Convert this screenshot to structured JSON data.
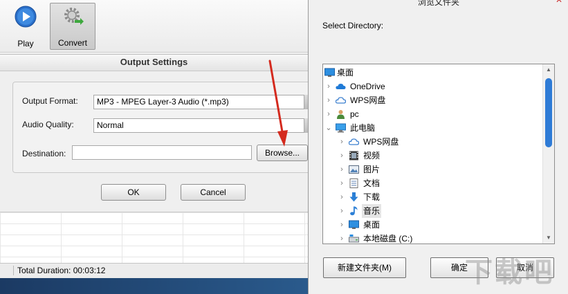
{
  "toolbar": {
    "play_label": "Play",
    "convert_label": "Convert"
  },
  "output_settings": {
    "title": "Output Settings",
    "output_format_label": "Output Format:",
    "output_format_value": "MP3 - MPEG Layer-3 Audio (*.mp3)",
    "audio_quality_label": "Audio Quality:",
    "audio_quality_value": "Normal",
    "destination_label": "Destination:",
    "destination_value": "",
    "browse_label": "Browse...",
    "ok_label": "OK",
    "cancel_label": "Cancel"
  },
  "status": {
    "total_duration": "Total Duration: 00:03:12"
  },
  "browse_dialog": {
    "title": "浏览文件夹",
    "select_directory_label": "Select Directory:",
    "tree": [
      {
        "label": "桌面",
        "icon": "desktop-icon",
        "level": 0,
        "expand": "none"
      },
      {
        "label": "OneDrive",
        "icon": "cloud-icon",
        "level": 1,
        "expand": "collapsed"
      },
      {
        "label": "WPS网盘",
        "icon": "cloud-outline-icon",
        "level": 1,
        "expand": "collapsed"
      },
      {
        "label": "pc",
        "icon": "user-icon",
        "level": 1,
        "expand": "collapsed"
      },
      {
        "label": "此电脑",
        "icon": "computer-icon",
        "level": 1,
        "expand": "expanded"
      },
      {
        "label": "WPS网盘",
        "icon": "cloud-outline-icon",
        "level": 2,
        "expand": "collapsed"
      },
      {
        "label": "视频",
        "icon": "video-icon",
        "level": 2,
        "expand": "collapsed"
      },
      {
        "label": "图片",
        "icon": "picture-icon",
        "level": 2,
        "expand": "collapsed"
      },
      {
        "label": "文档",
        "icon": "document-icon",
        "level": 2,
        "expand": "collapsed"
      },
      {
        "label": "下载",
        "icon": "download-icon",
        "level": 2,
        "expand": "collapsed"
      },
      {
        "label": "音乐",
        "icon": "music-icon",
        "level": 2,
        "expand": "collapsed",
        "selected": true
      },
      {
        "label": "桌面",
        "icon": "desktop-icon",
        "level": 2,
        "expand": "collapsed"
      },
      {
        "label": "本地磁盘 (C:)",
        "icon": "drive-icon",
        "level": 2,
        "expand": "collapsed"
      }
    ],
    "new_folder_label": "新建文件夹(M)",
    "confirm_label": "确定",
    "cancel_label": "取消"
  },
  "colors": {
    "accent_blue": "#2e7bd6",
    "annotation_arrow": "#d42a1e"
  },
  "watermark": "下载吧"
}
